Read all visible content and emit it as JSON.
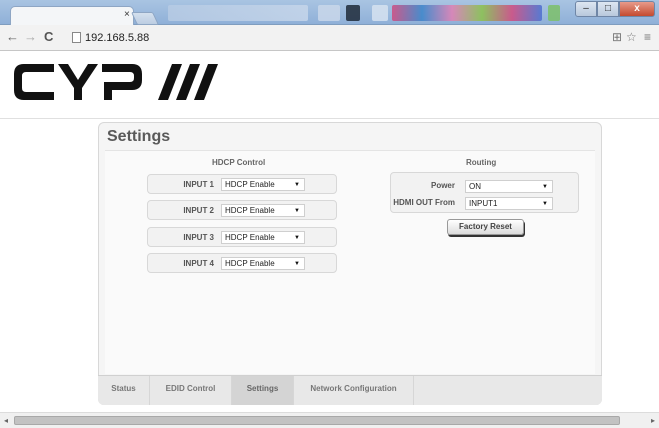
{
  "browser": {
    "tab_close": "×",
    "url": "192.168.5.88",
    "nav": {
      "back": "←",
      "forward": "→",
      "reload": "C"
    },
    "window_buttons": {
      "minimize": "–",
      "maximize": "□",
      "close": "x"
    },
    "right_icons": {
      "translate": "⊞",
      "star": "☆",
      "menu": "≡"
    }
  },
  "logo": {
    "text": "CYP///",
    "color": "#111111"
  },
  "panel": {
    "title": "Settings"
  },
  "hdcp": {
    "title": "HDCP Control",
    "inputs": [
      {
        "label": "INPUT 1",
        "value": "HDCP Enable"
      },
      {
        "label": "INPUT 2",
        "value": "HDCP Enable"
      },
      {
        "label": "INPUT 3",
        "value": "HDCP Enable"
      },
      {
        "label": "INPUT 4",
        "value": "HDCP Enable"
      }
    ]
  },
  "routing": {
    "title": "Routing",
    "power_label": "Power",
    "power_value": "ON",
    "hdmi_label": "HDMI OUT From",
    "hdmi_value": "INPUT1",
    "factory_reset": "Factory Reset"
  },
  "tabs": [
    {
      "label": "Status",
      "active": false
    },
    {
      "label": "EDID Control",
      "active": false
    },
    {
      "label": "Settings",
      "active": true
    },
    {
      "label": "Network Configuration",
      "active": false
    }
  ],
  "dropdown_arrow": "▼",
  "scroll": {
    "left": "◂",
    "right": "▸"
  }
}
